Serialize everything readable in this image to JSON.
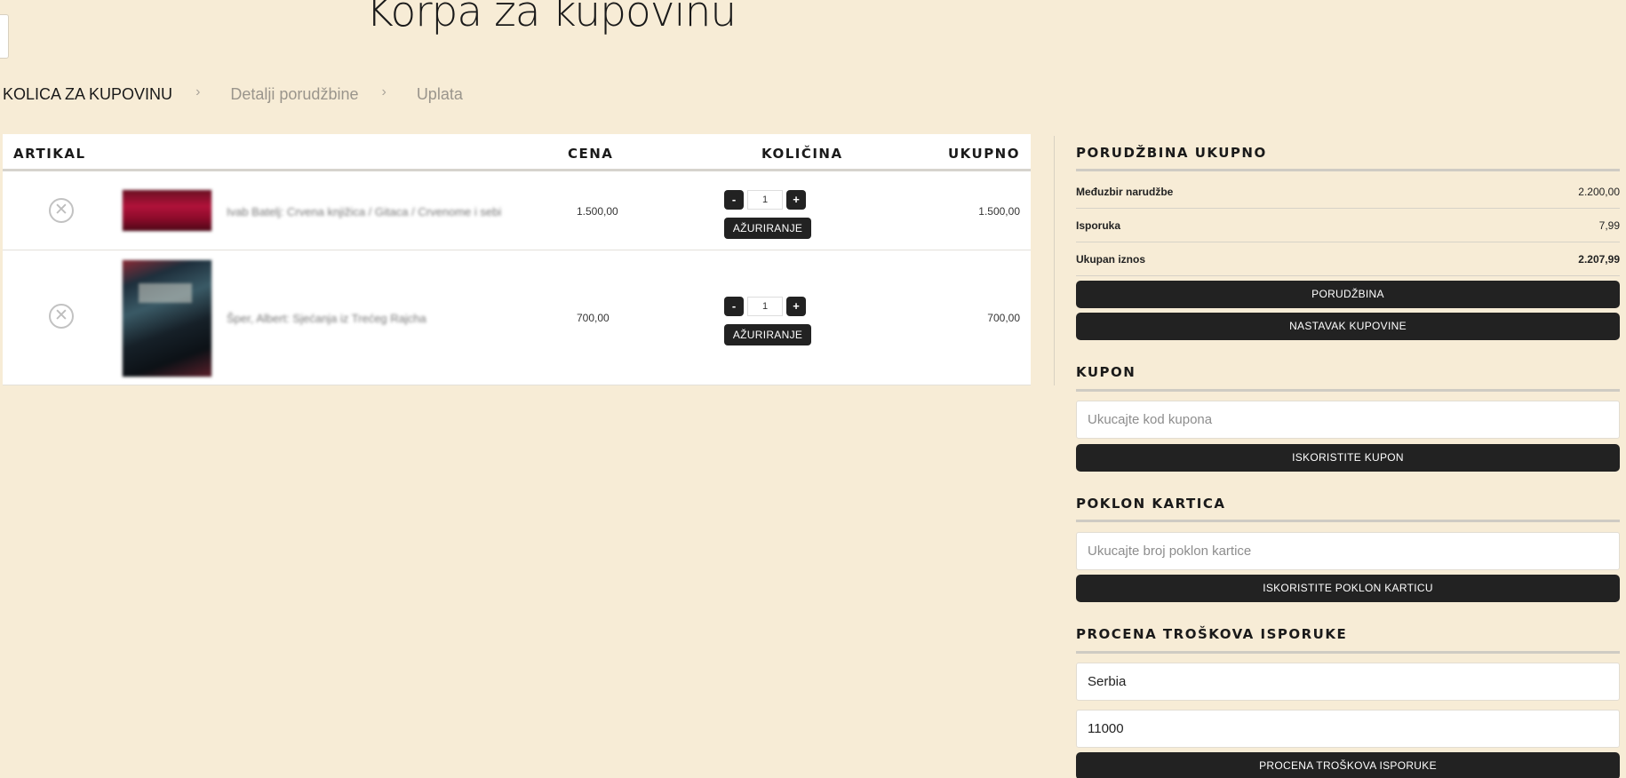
{
  "page": {
    "title": "Korpa za kupovinu"
  },
  "breadcrumb": {
    "steps": [
      "KOLICA ZA KUPOVINU",
      "Detalji porudžbine",
      "Uplata"
    ],
    "separator": "›"
  },
  "cart": {
    "headers": {
      "item": "ARTIKAL",
      "price": "CENA",
      "quantity": "KOLIČINA",
      "total": "UKUPNO"
    },
    "remove_symbol": "✕",
    "qty_minus": "-",
    "qty_plus": "+",
    "update_label": "AŽURIRANJE",
    "items": [
      {
        "name": "Ivab Batelj: Crvena knjižica / Gitaca / Crvenome i sebi",
        "price": "1.500,00",
        "quantity": "1",
        "total": "1.500,00"
      },
      {
        "name": "Šper, Albert: Sjećanja iz Trećeg Rajcha",
        "price": "700,00",
        "quantity": "1",
        "total": "700,00"
      }
    ]
  },
  "order_summary": {
    "title": "PORUDŽBINA UKUPNO",
    "rows": [
      {
        "label": "Međuzbir narudžbe",
        "value": "2.200,00"
      },
      {
        "label": "Isporuka",
        "value": "7,99"
      },
      {
        "label": "Ukupan iznos",
        "value": "2.207,99"
      }
    ],
    "checkout_label": "PORUDŽBINA",
    "continue_label": "NASTAVAK KUPOVINE"
  },
  "coupon": {
    "title": "KUPON",
    "placeholder": "Ukucajte kod kupona",
    "button": "ISKORISTITE KUPON"
  },
  "gift_card": {
    "title": "POKLON KARTICA",
    "placeholder": "Ukucajte broj poklon kartice",
    "button": "ISKORISTITE POKLON KARTICU"
  },
  "shipping_estimate": {
    "title": "PROCENA TROŠKOVA ISPORUKE",
    "country": "Serbia",
    "postcode": "11000",
    "button": "PROCENA TROŠKOVA ISPORUKE"
  },
  "colors": {
    "background": "#f7ecd6",
    "button": "#222222",
    "panel": "#ffffff"
  },
  "icons": [
    "remove-item-icon",
    "breadcrumb-chevron-icon"
  ]
}
